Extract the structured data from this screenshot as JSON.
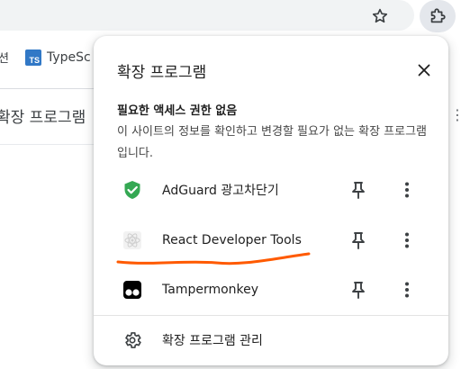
{
  "bookmarks": {
    "prefix_fragment": "션",
    "items": [
      {
        "label": "TypeSc",
        "icon": "typescript-icon",
        "icon_text": "TS"
      }
    ]
  },
  "page": {
    "heading_fragment": "확장 프로그램"
  },
  "popup": {
    "title": "확장 프로그램",
    "section_heading": "필요한 액세스 권한 없음",
    "section_description": "이 사이트의 정보를 확인하고 변경할 필요가 없는 확장 프로그램입니다.",
    "extensions": [
      {
        "name": "AdGuard 광고차단기",
        "icon": "adguard-shield-icon",
        "pinned": false
      },
      {
        "name": "React Developer Tools",
        "icon": "react-devtools-icon",
        "pinned": false
      },
      {
        "name": "Tampermonkey",
        "icon": "tampermonkey-icon",
        "pinned": false
      }
    ],
    "manage_label": "확장 프로그램 관리"
  },
  "colors": {
    "adguard_green": "#34a853",
    "annotation_orange": "#ff5a00",
    "typescript_blue": "#3178c6"
  }
}
